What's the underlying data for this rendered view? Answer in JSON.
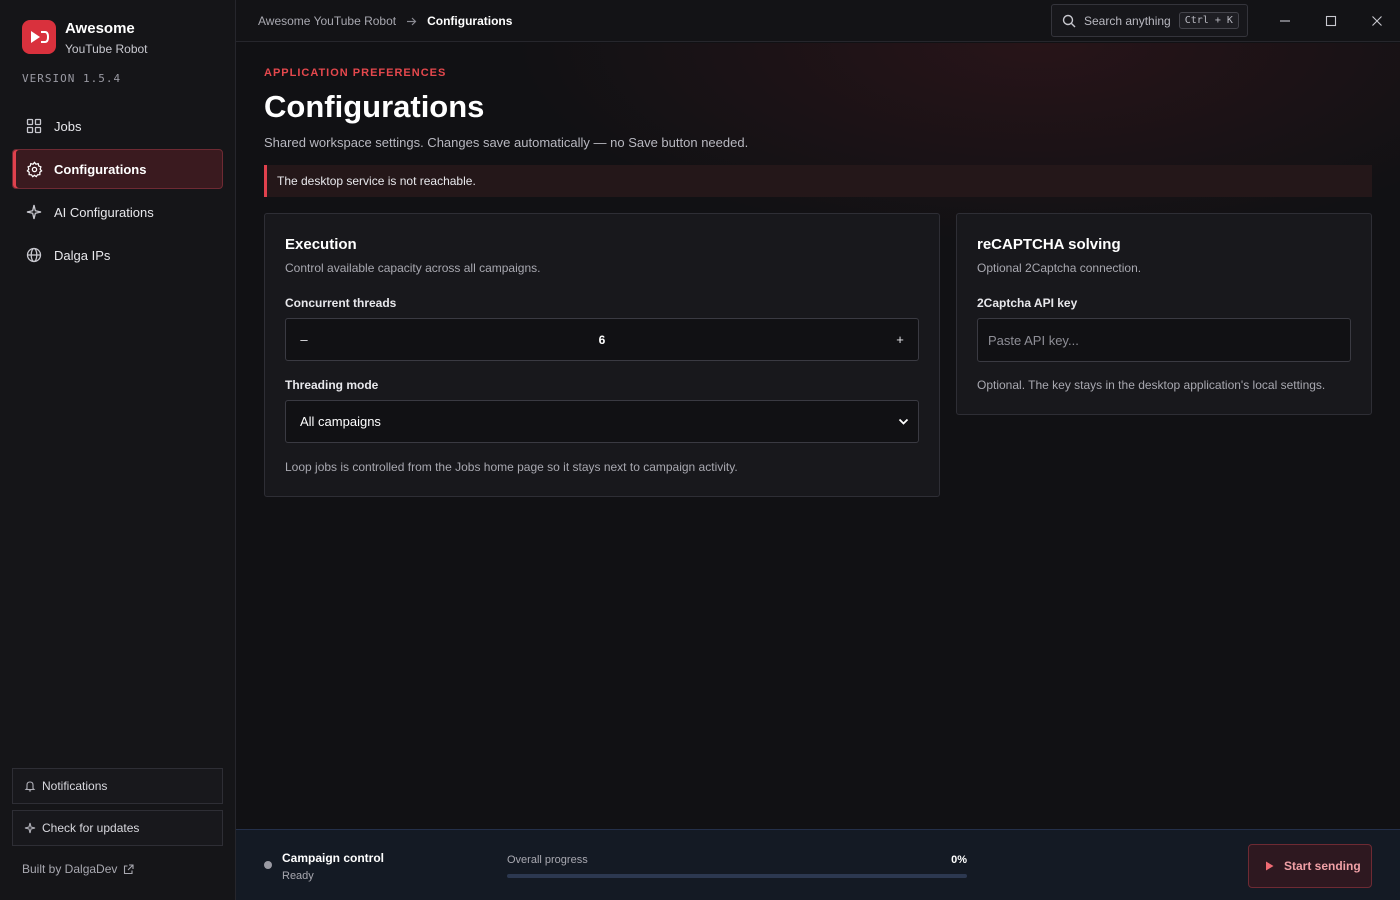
{
  "brand": {
    "title": "Awesome",
    "subtitle": "YouTube Robot",
    "version": "VERSION 1.5.4",
    "logo_color": "#d9313d"
  },
  "nav": {
    "items": [
      {
        "label": "Jobs",
        "icon": "grid-icon",
        "active": false
      },
      {
        "label": "Configurations",
        "icon": "gear-icon",
        "active": true
      },
      {
        "label": "AI Configurations",
        "icon": "sparkle-icon",
        "active": false
      },
      {
        "label": "Dalga IPs",
        "icon": "globe-icon",
        "active": false
      }
    ]
  },
  "sidebar_footer": {
    "notifications_label": "Notifications",
    "updates_label": "Check for updates",
    "built_by": "Built by DalgaDev"
  },
  "topbar": {
    "breadcrumb_root": "Awesome YouTube Robot",
    "breadcrumb_current": "Configurations",
    "search_label": "Search anything",
    "search_shortcut": "Ctrl + K"
  },
  "page": {
    "eyebrow": "APPLICATION PREFERENCES",
    "title": "Configurations",
    "description": "Shared workspace settings. Changes save automatically — no Save button needed.",
    "alert": "The desktop service is not reachable."
  },
  "execution": {
    "title": "Execution",
    "subtitle": "Control available capacity across all campaigns.",
    "threads_label": "Concurrent threads",
    "threads_value": "6",
    "decrement_label": "–",
    "increment_label": "+",
    "mode_label": "Threading mode",
    "mode_value": "All campaigns",
    "note": "Loop jobs is controlled from the Jobs home page so it stays next to campaign activity."
  },
  "recaptcha": {
    "title": "reCAPTCHA solving",
    "subtitle": "Optional 2Captcha connection.",
    "key_label": "2Captcha API key",
    "key_placeholder": "Paste API key...",
    "note": "Optional. The key stays in the desktop application's local settings."
  },
  "footer": {
    "campaign_title": "Campaign control",
    "campaign_status": "Ready",
    "progress_label": "Overall progress",
    "progress_text": "0%",
    "progress_value": 0,
    "start_label": "Start sending"
  },
  "colors": {
    "accent": "#e0414d",
    "background": "#111114",
    "sidebar": "#151518"
  }
}
